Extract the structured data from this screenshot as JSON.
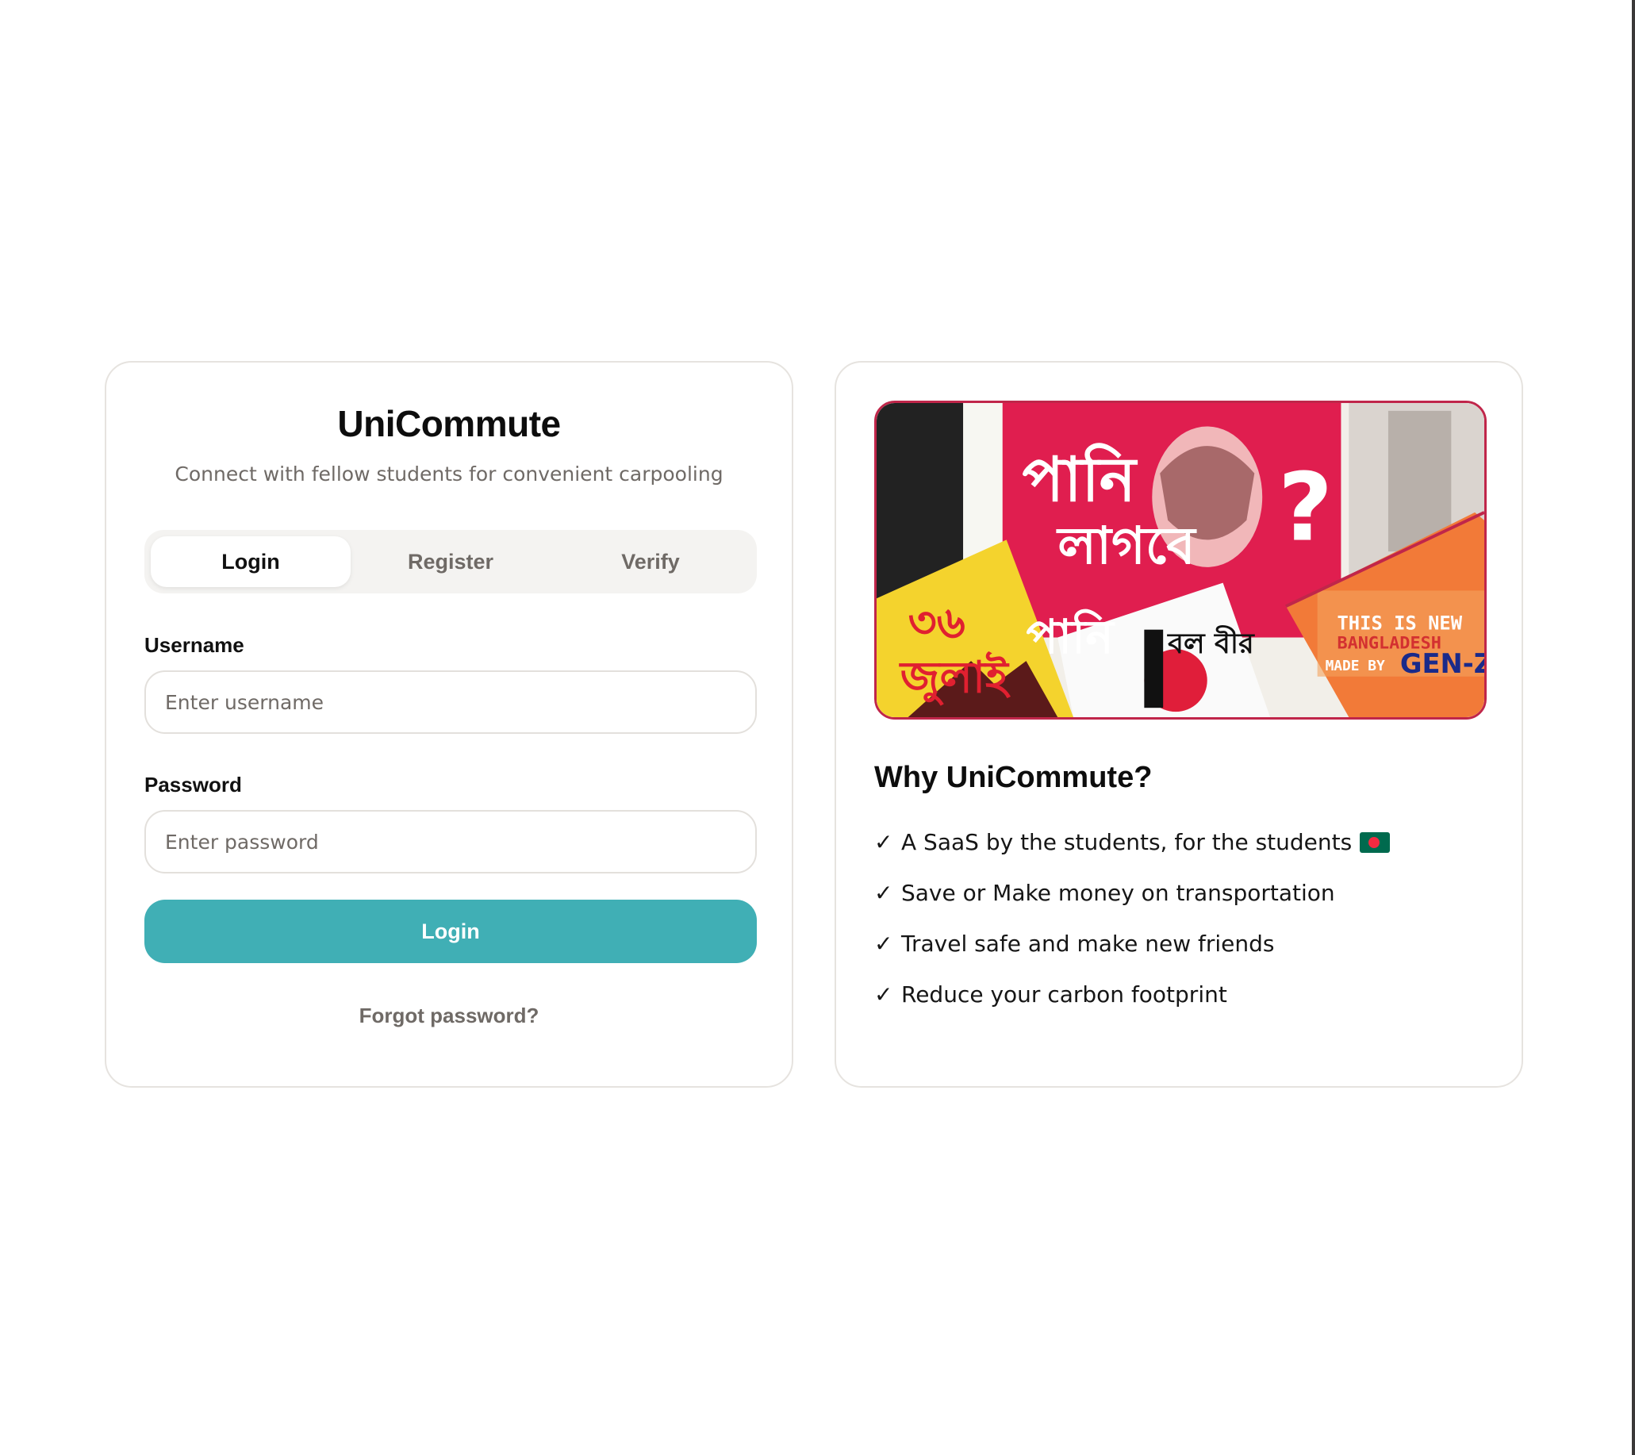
{
  "app": {
    "title": "UniCommute",
    "subtitle": "Connect with fellow students for convenient carpooling"
  },
  "tabs": [
    {
      "label": "Login",
      "active": true
    },
    {
      "label": "Register",
      "active": false
    },
    {
      "label": "Verify",
      "active": false
    }
  ],
  "form": {
    "username_label": "Username",
    "username_placeholder": "Enter username",
    "username_value": "",
    "password_label": "Password",
    "password_placeholder": "Enter password",
    "password_value": "",
    "submit_label": "Login",
    "forgot_label": "Forgot password?"
  },
  "info": {
    "hero_image": {
      "texts": [
        "THIS IS NEW",
        "BANGLADESH",
        "MADE BY",
        "GEN-Z"
      ]
    },
    "title": "Why UniCommute?",
    "check_mark": "✓",
    "features": [
      {
        "text": "A SaaS by the students, for the students",
        "flag_icon": "bangladesh-flag-icon"
      },
      {
        "text": "Save or Make money on transportation"
      },
      {
        "text": "Travel safe and make new friends"
      },
      {
        "text": "Reduce your carbon footprint"
      }
    ]
  },
  "colors": {
    "accent": "#40afb5",
    "muted_text": "#6f6a66",
    "card_border": "#e6e3df",
    "tabs_background": "#f4f3f1",
    "hero_border": "#c0264a"
  }
}
